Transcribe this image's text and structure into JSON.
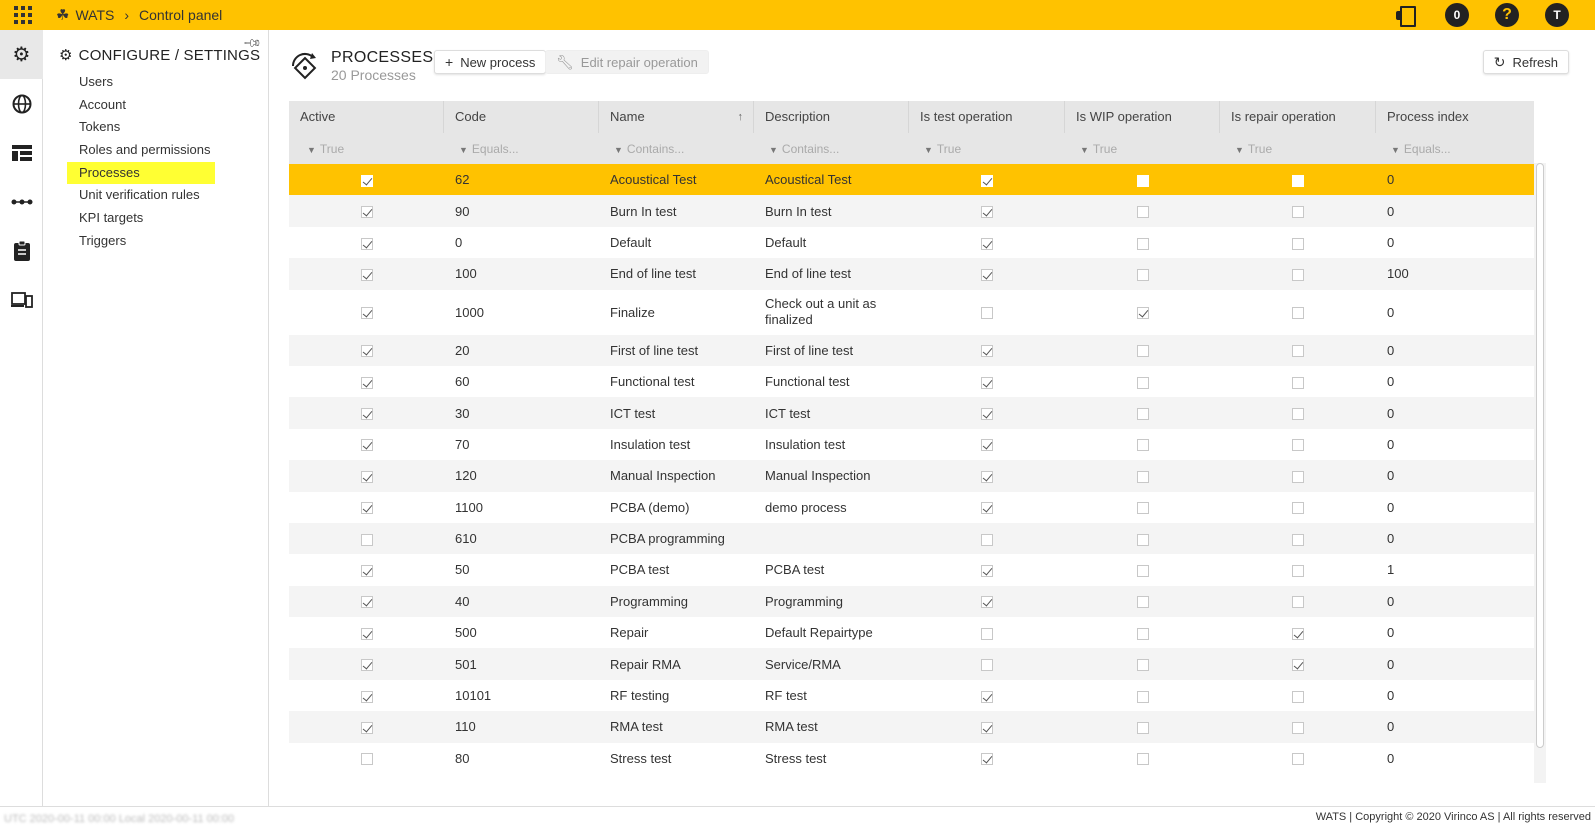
{
  "topbar": {
    "app_name": "WATS",
    "breadcrumb": "Control panel",
    "notifications": "0",
    "help": "?",
    "user_initial": "T"
  },
  "rail": [
    "gear-icon",
    "globe-icon",
    "dashboard-icon",
    "flow-icon",
    "clipboard-icon",
    "devices-icon"
  ],
  "panel": {
    "heading": "CONFIGURE / SETTINGS",
    "items": [
      "Users",
      "Account",
      "Tokens",
      "Roles and permissions",
      "Processes",
      "Unit verification rules",
      "KPI targets",
      "Triggers"
    ],
    "active_index": 4
  },
  "page": {
    "title": "PROCESSES",
    "subtitle": "20 Processes",
    "new_button": "New process",
    "edit_button": "Edit repair operation",
    "refresh_button": "Refresh"
  },
  "table": {
    "headers": [
      "Active",
      "Code",
      "Name",
      "Description",
      "Is test operation",
      "Is WIP operation",
      "Is repair operation",
      "Process index"
    ],
    "filters": [
      "True",
      "Equals...",
      "Contains...",
      "Contains...",
      "True",
      "True",
      "True",
      "Equals..."
    ],
    "rows": [
      {
        "active": true,
        "code": "62",
        "name": "Acoustical Test",
        "desc": "Acoustical Test",
        "test": true,
        "wip": false,
        "repair": false,
        "index": "0"
      },
      {
        "active": true,
        "code": "90",
        "name": "Burn In test",
        "desc": "Burn In test",
        "test": true,
        "wip": false,
        "repair": false,
        "index": "0"
      },
      {
        "active": true,
        "code": "0",
        "name": "Default",
        "desc": "Default",
        "test": true,
        "wip": false,
        "repair": false,
        "index": "0"
      },
      {
        "active": true,
        "code": "100",
        "name": "End of line test",
        "desc": "End of line test",
        "test": true,
        "wip": false,
        "repair": false,
        "index": "100"
      },
      {
        "active": true,
        "code": "1000",
        "name": "Finalize",
        "desc": "Check out a unit as finalized",
        "test": false,
        "wip": true,
        "repair": false,
        "index": "0"
      },
      {
        "active": true,
        "code": "20",
        "name": "First of line test",
        "desc": "First of line test",
        "test": true,
        "wip": false,
        "repair": false,
        "index": "0"
      },
      {
        "active": true,
        "code": "60",
        "name": "Functional test",
        "desc": "Functional test",
        "test": true,
        "wip": false,
        "repair": false,
        "index": "0"
      },
      {
        "active": true,
        "code": "30",
        "name": "ICT test",
        "desc": "ICT test",
        "test": true,
        "wip": false,
        "repair": false,
        "index": "0"
      },
      {
        "active": true,
        "code": "70",
        "name": "Insulation test",
        "desc": "Insulation test",
        "test": true,
        "wip": false,
        "repair": false,
        "index": "0"
      },
      {
        "active": true,
        "code": "120",
        "name": "Manual Inspection",
        "desc": "Manual Inspection",
        "test": true,
        "wip": false,
        "repair": false,
        "index": "0"
      },
      {
        "active": true,
        "code": "1100",
        "name": "PCBA (demo)",
        "desc": "demo process",
        "test": true,
        "wip": false,
        "repair": false,
        "index": "0"
      },
      {
        "active": false,
        "code": "610",
        "name": "PCBA programming",
        "desc": "",
        "test": false,
        "wip": false,
        "repair": false,
        "index": "0"
      },
      {
        "active": true,
        "code": "50",
        "name": "PCBA test",
        "desc": "PCBA test",
        "test": true,
        "wip": false,
        "repair": false,
        "index": "1"
      },
      {
        "active": true,
        "code": "40",
        "name": "Programming",
        "desc": "Programming",
        "test": true,
        "wip": false,
        "repair": false,
        "index": "0"
      },
      {
        "active": true,
        "code": "500",
        "name": "Repair",
        "desc": "Default Repairtype",
        "test": false,
        "wip": false,
        "repair": true,
        "index": "0"
      },
      {
        "active": true,
        "code": "501",
        "name": "Repair RMA",
        "desc": "Service/RMA",
        "test": false,
        "wip": false,
        "repair": true,
        "index": "0"
      },
      {
        "active": true,
        "code": "10101",
        "name": "RF testing",
        "desc": "RF test",
        "test": true,
        "wip": false,
        "repair": false,
        "index": "0"
      },
      {
        "active": true,
        "code": "110",
        "name": "RMA test",
        "desc": "RMA test",
        "test": true,
        "wip": false,
        "repair": false,
        "index": "0"
      },
      {
        "active": false,
        "code": "80",
        "name": "Stress test",
        "desc": "Stress test",
        "test": true,
        "wip": false,
        "repair": false,
        "index": "0"
      }
    ],
    "selected_row": 0
  },
  "footer": {
    "time_info": "UTC 2020-00-11 00:00   Local 2020-00-11 00:00",
    "copyright": "WATS | Copyright © 2020 Virinco AS | All rights reserved"
  }
}
